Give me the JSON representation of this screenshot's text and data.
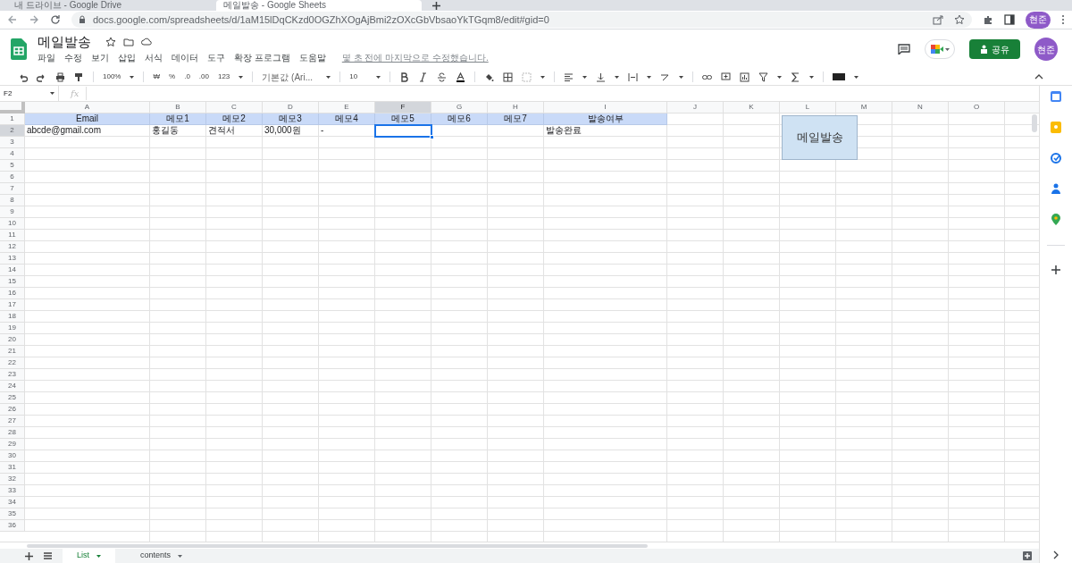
{
  "browser": {
    "tabs": [
      {
        "title": "내 드라이브 - Google Drive",
        "selected": false
      },
      {
        "title": "메일발송 - Google Sheets",
        "selected": true
      }
    ],
    "url": "docs.google.com/spreadsheets/d/1aM15lDqCKzd0OGZhXOgAjBmi2zOXcGbVbsaoYkTGqm8/edit#gid=0",
    "profile": "현준"
  },
  "document": {
    "title": "메일발송",
    "menu": [
      "파일",
      "수정",
      "보기",
      "삽입",
      "서식",
      "데이터",
      "도구",
      "확장 프로그램",
      "도움말"
    ],
    "last_edit": "몇 초 전에 마지막으로 수정했습니다.",
    "share_label": "공유",
    "avatar": "현준"
  },
  "toolbar": {
    "zoom": "100%",
    "currency": "₩",
    "percent": "%",
    "decrease_decimal": ".0",
    "increase_decimal": ".00",
    "format": "123",
    "font": "기본값 (Ari...",
    "font_size": "10"
  },
  "name_box": "F2",
  "formula_hint": "fx",
  "sheet": {
    "columns": [
      {
        "label": "A",
        "selected": false
      },
      {
        "label": "B",
        "selected": false
      },
      {
        "label": "C",
        "selected": false
      },
      {
        "label": "D",
        "selected": false
      },
      {
        "label": "E",
        "selected": false
      },
      {
        "label": "F",
        "selected": true
      },
      {
        "label": "G",
        "selected": false
      },
      {
        "label": "H",
        "selected": false
      },
      {
        "label": "I",
        "selected": false
      },
      {
        "label": "J",
        "selected": false
      },
      {
        "label": "K",
        "selected": false
      },
      {
        "label": "L",
        "selected": false
      },
      {
        "label": "M",
        "selected": false
      },
      {
        "label": "N",
        "selected": false
      },
      {
        "label": "O",
        "selected": false
      }
    ],
    "rows": [
      {
        "number": "1",
        "kind": "header",
        "selected": false,
        "cells": [
          "Email",
          "메모1",
          "메모2",
          "메모3",
          "메모4",
          "메모5",
          "메모6",
          "메모7",
          "발송여부"
        ]
      },
      {
        "number": "2",
        "kind": "data",
        "selected": true,
        "cells": [
          "abcde@gmail.com",
          "홍길동",
          "견적서",
          "30,000원",
          "-",
          "",
          "",
          "",
          "발송완료"
        ]
      },
      {
        "number": "3"
      },
      {
        "number": "4"
      },
      {
        "number": "5"
      },
      {
        "number": "6"
      },
      {
        "number": "7"
      },
      {
        "number": "8"
      },
      {
        "number": "9"
      },
      {
        "number": "10"
      },
      {
        "number": "11"
      },
      {
        "number": "12"
      },
      {
        "number": "13"
      },
      {
        "number": "14"
      },
      {
        "number": "15"
      },
      {
        "number": "16"
      },
      {
        "number": "17"
      },
      {
        "number": "18"
      },
      {
        "number": "19"
      },
      {
        "number": "20"
      },
      {
        "number": "21"
      },
      {
        "number": "22"
      },
      {
        "number": "23"
      },
      {
        "number": "24"
      },
      {
        "number": "25"
      },
      {
        "number": "26"
      },
      {
        "number": "27"
      },
      {
        "number": "28"
      },
      {
        "number": "29"
      },
      {
        "number": "30"
      },
      {
        "number": "31"
      },
      {
        "number": "32"
      },
      {
        "number": "33"
      },
      {
        "number": "34"
      },
      {
        "number": "35"
      },
      {
        "number": "36"
      }
    ],
    "drawing_button": "메일발송"
  },
  "sheet_tabs": [
    {
      "label": "List",
      "selected": true
    },
    {
      "label": "contents",
      "selected": false
    }
  ]
}
